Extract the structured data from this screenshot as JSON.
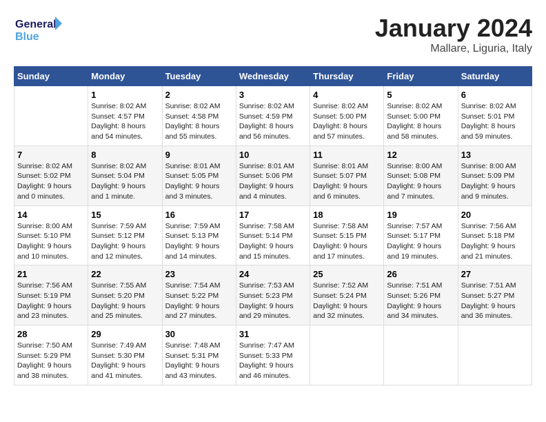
{
  "header": {
    "logo_line1": "General",
    "logo_line2": "Blue",
    "month": "January 2024",
    "location": "Mallare, Liguria, Italy"
  },
  "weekdays": [
    "Sunday",
    "Monday",
    "Tuesday",
    "Wednesday",
    "Thursday",
    "Friday",
    "Saturday"
  ],
  "weeks": [
    [
      {
        "day": "",
        "info": ""
      },
      {
        "day": "1",
        "info": "Sunrise: 8:02 AM\nSunset: 4:57 PM\nDaylight: 8 hours\nand 54 minutes."
      },
      {
        "day": "2",
        "info": "Sunrise: 8:02 AM\nSunset: 4:58 PM\nDaylight: 8 hours\nand 55 minutes."
      },
      {
        "day": "3",
        "info": "Sunrise: 8:02 AM\nSunset: 4:59 PM\nDaylight: 8 hours\nand 56 minutes."
      },
      {
        "day": "4",
        "info": "Sunrise: 8:02 AM\nSunset: 5:00 PM\nDaylight: 8 hours\nand 57 minutes."
      },
      {
        "day": "5",
        "info": "Sunrise: 8:02 AM\nSunset: 5:00 PM\nDaylight: 8 hours\nand 58 minutes."
      },
      {
        "day": "6",
        "info": "Sunrise: 8:02 AM\nSunset: 5:01 PM\nDaylight: 8 hours\nand 59 minutes."
      }
    ],
    [
      {
        "day": "7",
        "info": "Sunrise: 8:02 AM\nSunset: 5:02 PM\nDaylight: 9 hours\nand 0 minutes."
      },
      {
        "day": "8",
        "info": "Sunrise: 8:02 AM\nSunset: 5:04 PM\nDaylight: 9 hours\nand 1 minute."
      },
      {
        "day": "9",
        "info": "Sunrise: 8:01 AM\nSunset: 5:05 PM\nDaylight: 9 hours\nand 3 minutes."
      },
      {
        "day": "10",
        "info": "Sunrise: 8:01 AM\nSunset: 5:06 PM\nDaylight: 9 hours\nand 4 minutes."
      },
      {
        "day": "11",
        "info": "Sunrise: 8:01 AM\nSunset: 5:07 PM\nDaylight: 9 hours\nand 6 minutes."
      },
      {
        "day": "12",
        "info": "Sunrise: 8:00 AM\nSunset: 5:08 PM\nDaylight: 9 hours\nand 7 minutes."
      },
      {
        "day": "13",
        "info": "Sunrise: 8:00 AM\nSunset: 5:09 PM\nDaylight: 9 hours\nand 9 minutes."
      }
    ],
    [
      {
        "day": "14",
        "info": "Sunrise: 8:00 AM\nSunset: 5:10 PM\nDaylight: 9 hours\nand 10 minutes."
      },
      {
        "day": "15",
        "info": "Sunrise: 7:59 AM\nSunset: 5:12 PM\nDaylight: 9 hours\nand 12 minutes."
      },
      {
        "day": "16",
        "info": "Sunrise: 7:59 AM\nSunset: 5:13 PM\nDaylight: 9 hours\nand 14 minutes."
      },
      {
        "day": "17",
        "info": "Sunrise: 7:58 AM\nSunset: 5:14 PM\nDaylight: 9 hours\nand 15 minutes."
      },
      {
        "day": "18",
        "info": "Sunrise: 7:58 AM\nSunset: 5:15 PM\nDaylight: 9 hours\nand 17 minutes."
      },
      {
        "day": "19",
        "info": "Sunrise: 7:57 AM\nSunset: 5:17 PM\nDaylight: 9 hours\nand 19 minutes."
      },
      {
        "day": "20",
        "info": "Sunrise: 7:56 AM\nSunset: 5:18 PM\nDaylight: 9 hours\nand 21 minutes."
      }
    ],
    [
      {
        "day": "21",
        "info": "Sunrise: 7:56 AM\nSunset: 5:19 PM\nDaylight: 9 hours\nand 23 minutes."
      },
      {
        "day": "22",
        "info": "Sunrise: 7:55 AM\nSunset: 5:20 PM\nDaylight: 9 hours\nand 25 minutes."
      },
      {
        "day": "23",
        "info": "Sunrise: 7:54 AM\nSunset: 5:22 PM\nDaylight: 9 hours\nand 27 minutes."
      },
      {
        "day": "24",
        "info": "Sunrise: 7:53 AM\nSunset: 5:23 PM\nDaylight: 9 hours\nand 29 minutes."
      },
      {
        "day": "25",
        "info": "Sunrise: 7:52 AM\nSunset: 5:24 PM\nDaylight: 9 hours\nand 32 minutes."
      },
      {
        "day": "26",
        "info": "Sunrise: 7:51 AM\nSunset: 5:26 PM\nDaylight: 9 hours\nand 34 minutes."
      },
      {
        "day": "27",
        "info": "Sunrise: 7:51 AM\nSunset: 5:27 PM\nDaylight: 9 hours\nand 36 minutes."
      }
    ],
    [
      {
        "day": "28",
        "info": "Sunrise: 7:50 AM\nSunset: 5:29 PM\nDaylight: 9 hours\nand 38 minutes."
      },
      {
        "day": "29",
        "info": "Sunrise: 7:49 AM\nSunset: 5:30 PM\nDaylight: 9 hours\nand 41 minutes."
      },
      {
        "day": "30",
        "info": "Sunrise: 7:48 AM\nSunset: 5:31 PM\nDaylight: 9 hours\nand 43 minutes."
      },
      {
        "day": "31",
        "info": "Sunrise: 7:47 AM\nSunset: 5:33 PM\nDaylight: 9 hours\nand 46 minutes."
      },
      {
        "day": "",
        "info": ""
      },
      {
        "day": "",
        "info": ""
      },
      {
        "day": "",
        "info": ""
      }
    ]
  ]
}
